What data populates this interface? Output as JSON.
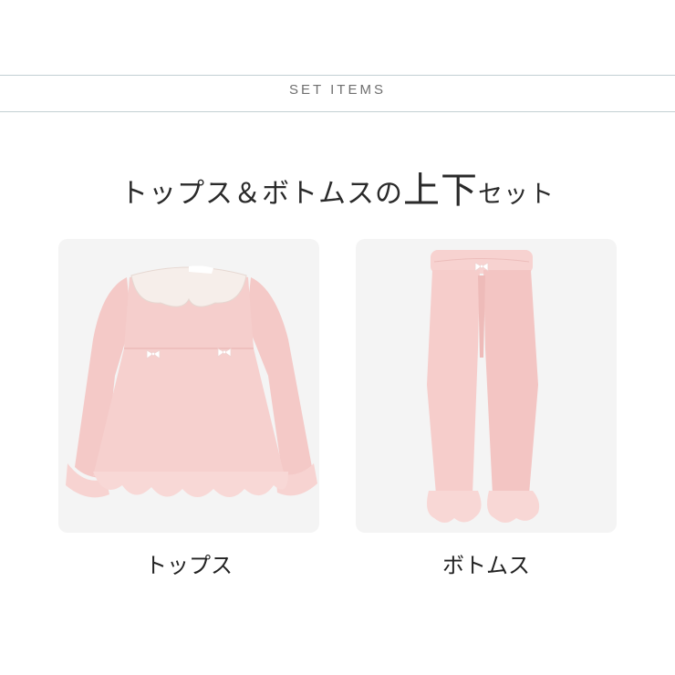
{
  "section": {
    "label": "SET ITEMS"
  },
  "headline": {
    "part1": "トップス＆ボトムスの",
    "part2": "上下",
    "part3": "セット"
  },
  "items": [
    {
      "label": "トップス",
      "icon": "pink-tunic-top-image"
    },
    {
      "label": "ボトムス",
      "icon": "pink-pants-image"
    }
  ],
  "colors": {
    "garment": "#f6cfcd",
    "card": "#f4f4f4",
    "rule": "#c3d0d3"
  }
}
